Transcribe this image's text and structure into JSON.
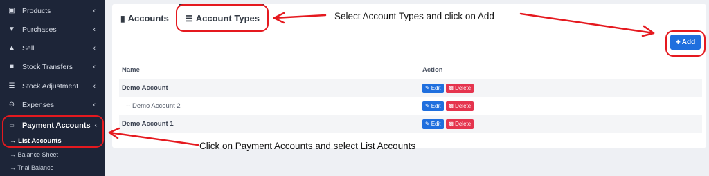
{
  "sidebar": {
    "items": [
      {
        "label": "Products",
        "icon": "cubes-icon"
      },
      {
        "label": "Purchases",
        "icon": "arrow-circle-down-icon"
      },
      {
        "label": "Sell",
        "icon": "arrow-circle-up-icon"
      },
      {
        "label": "Stock Transfers",
        "icon": "truck-icon"
      },
      {
        "label": "Stock Adjustment",
        "icon": "database-icon"
      },
      {
        "label": "Expenses",
        "icon": "minus-circle-icon"
      },
      {
        "label": "Payment Accounts",
        "icon": "money-card-icon"
      }
    ],
    "subitems": [
      {
        "label": "→ List Accounts"
      },
      {
        "label": "→ Balance Sheet"
      },
      {
        "label": "→ Trial Balance"
      }
    ]
  },
  "tabs": {
    "accounts": "Accounts",
    "account_types": "Account Types"
  },
  "add_button": "Add",
  "table": {
    "columns": [
      "Name",
      "Action"
    ],
    "rows": [
      {
        "name": "Demo Account",
        "edit": "Edit",
        "delete": "Delete"
      },
      {
        "name": "-- Demo Account 2",
        "edit": "Edit",
        "delete": "Delete"
      },
      {
        "name": "Demo Account 1",
        "edit": "Edit",
        "delete": "Delete"
      }
    ]
  },
  "annotations": {
    "top": "Select Account Types and click on Add",
    "bottom": "Click on Payment Accounts and select List Accounts",
    "color": "#e5191f"
  }
}
